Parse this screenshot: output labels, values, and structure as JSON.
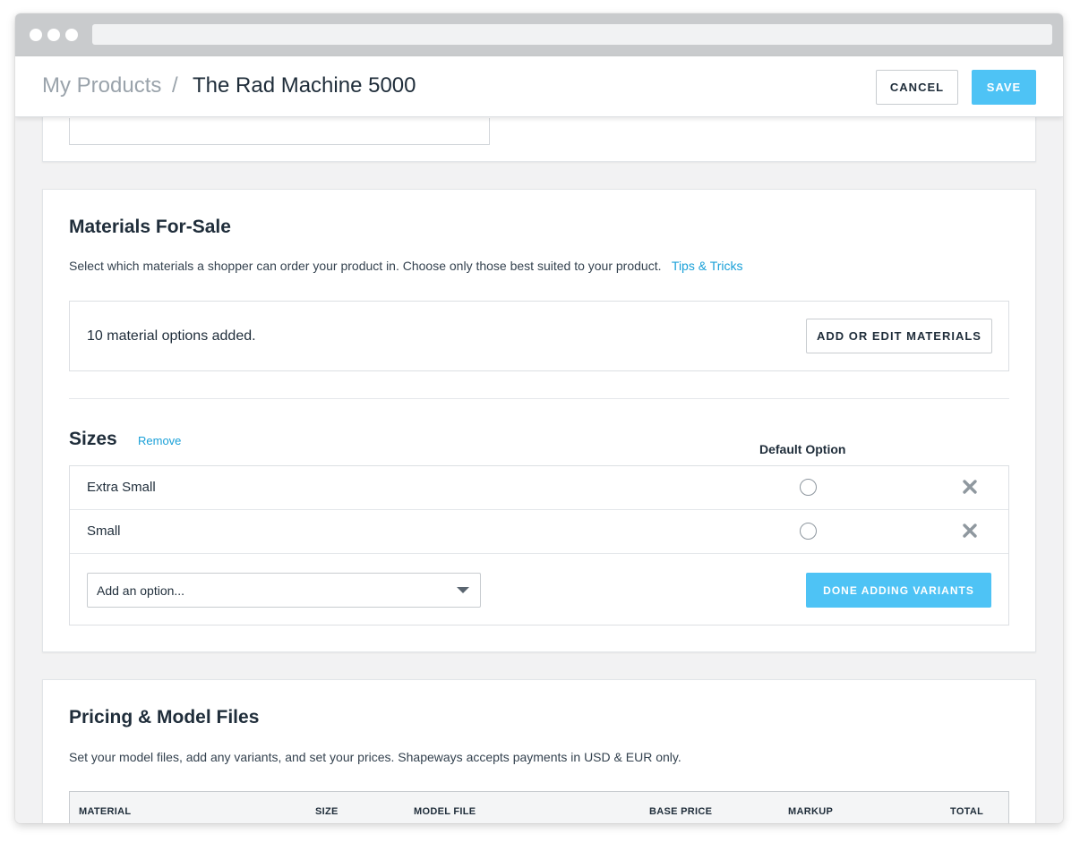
{
  "breadcrumb": {
    "root": "My Products",
    "separator": "/",
    "current": "The Rad Machine 5000"
  },
  "header": {
    "cancel_label": "CANCEL",
    "save_label": "SAVE"
  },
  "materials": {
    "title": "Materials For-Sale",
    "description": "Select which materials a shopper can order your product in. Choose only those best suited to your product.",
    "tips_link": "Tips & Tricks",
    "summary": "10 material options added.",
    "edit_button": "ADD OR EDIT MATERIALS"
  },
  "sizes": {
    "title": "Sizes",
    "remove_link": "Remove",
    "default_label": "Default Option",
    "options": [
      {
        "label": "Extra Small"
      },
      {
        "label": "Small"
      }
    ],
    "add_placeholder": "Add an option...",
    "done_button": "DONE ADDING VARIANTS"
  },
  "pricing": {
    "title": "Pricing & Model Files",
    "description": "Set your model files, add any variants, and set your prices. Shapeways accepts payments in USD & EUR only.",
    "columns": [
      "MATERIAL",
      "SIZE",
      "MODEL FILE",
      "BASE PRICE",
      "MARKUP",
      "TOTAL"
    ]
  },
  "colors": {
    "accent": "#4ec3f5",
    "link": "#1aa0d8",
    "text": "#1f2d3a"
  }
}
